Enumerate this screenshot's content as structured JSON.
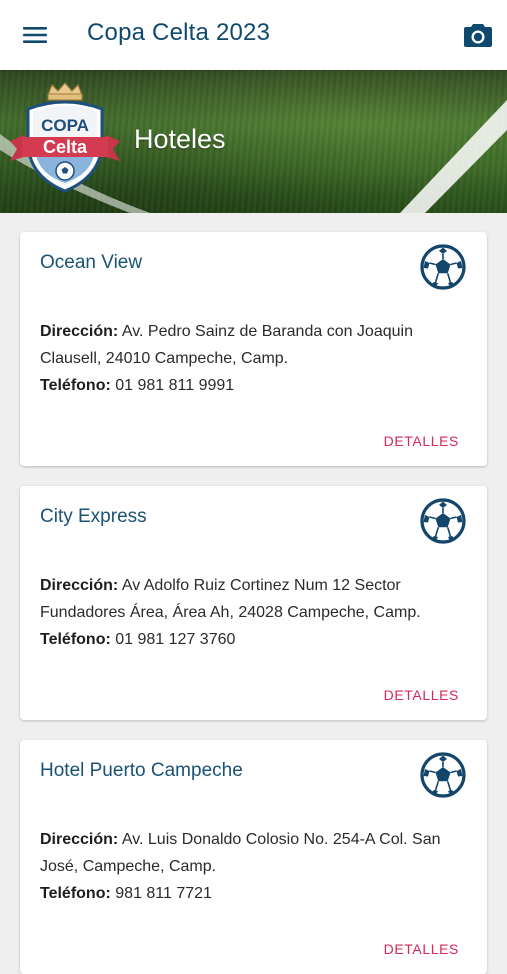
{
  "app_bar": {
    "title": "Copa Celta 2023",
    "menu_icon": "hamburger-menu-icon",
    "camera_icon": "camera-icon"
  },
  "banner": {
    "title": "Hoteles",
    "logo": {
      "line1": "COPA",
      "line2": "Celta"
    }
  },
  "hotels": [
    {
      "name": "Ocean View",
      "address_label": "Dirección:",
      "address": "Av. Pedro Sainz de Baranda con Joaquin Clausell, 24010 Campeche, Camp.",
      "phone_label": "Teléfono:",
      "phone": "01 981 811 9991",
      "action": "DETALLES"
    },
    {
      "name": "City Express",
      "address_label": "Dirección:",
      "address": "Av Adolfo Ruiz Cortinez Num 12 Sector Fundadores Área, Área Ah, 24028 Campeche, Camp.",
      "phone_label": "Teléfono:",
      "phone": "01 981 127 3760",
      "action": "DETALLES"
    },
    {
      "name": "Hotel Puerto Campeche",
      "address_label": "Dirección:",
      "address": "Av. Luis Donaldo Colosio No. 254-A Col. San José, Campeche, Camp.",
      "phone_label": "Teléfono:",
      "phone": "981 811 7721",
      "action": "DETALLES"
    }
  ],
  "colors": {
    "primary": "#0f4a6e",
    "accent": "#d6285a",
    "background": "#efefef"
  }
}
